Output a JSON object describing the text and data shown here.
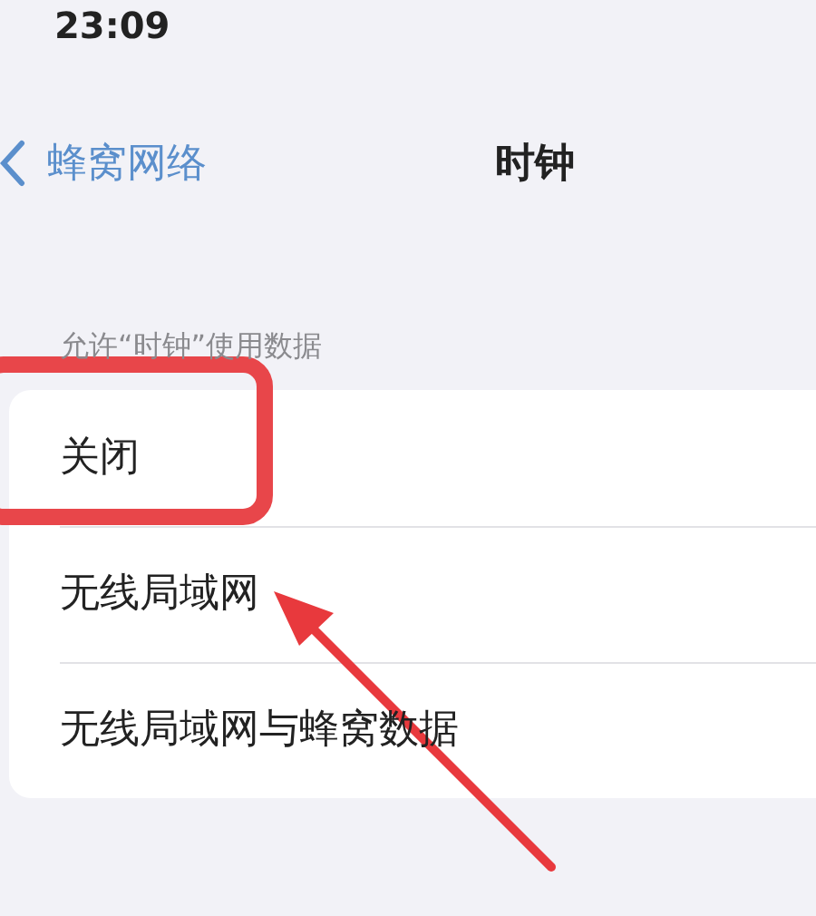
{
  "status_bar": {
    "time": "23:09"
  },
  "nav": {
    "back_label": "蜂窝网络",
    "title": "时钟"
  },
  "section": {
    "header": "允许“时钟”使用数据",
    "options": [
      {
        "label": "关闭"
      },
      {
        "label": "无线局域网"
      },
      {
        "label": "无线局域网与蜂窝数据"
      }
    ]
  }
}
